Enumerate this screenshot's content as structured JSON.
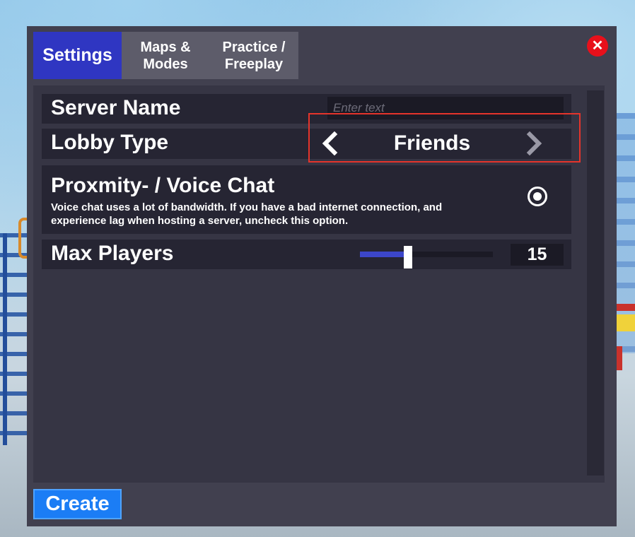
{
  "tabs": [
    {
      "label": "Settings",
      "active": true
    },
    {
      "label": "Maps &\nModes",
      "active": false
    },
    {
      "label": "Practice /\nFreeplay",
      "active": false
    }
  ],
  "close_button": {
    "glyph": "✕",
    "icon": "close-icon",
    "color": "#e8101b"
  },
  "settings": {
    "server_name": {
      "label": "Server Name",
      "value": "",
      "placeholder": "Enter text"
    },
    "lobby_type": {
      "label": "Lobby Type",
      "value": "Friends",
      "prev_icon": "chevron-left-icon",
      "next_icon": "chevron-right-icon"
    },
    "voice_chat": {
      "label": "Proxmity- / Voice Chat",
      "description": "Voice chat uses a lot of bandwidth. If you have a bad internet connection, and experience lag when hosting a server, uncheck this option.",
      "enabled": true
    },
    "max_players": {
      "label": "Max Players",
      "value": "15",
      "slider_fraction": 0.36
    }
  },
  "create_button": {
    "label": "Create"
  },
  "colors": {
    "accent": "#2f36c2",
    "tab_inactive": "#5d5c6a",
    "panel": "#41404f",
    "create": "#1b7df5",
    "highlight": "#e5342b"
  }
}
